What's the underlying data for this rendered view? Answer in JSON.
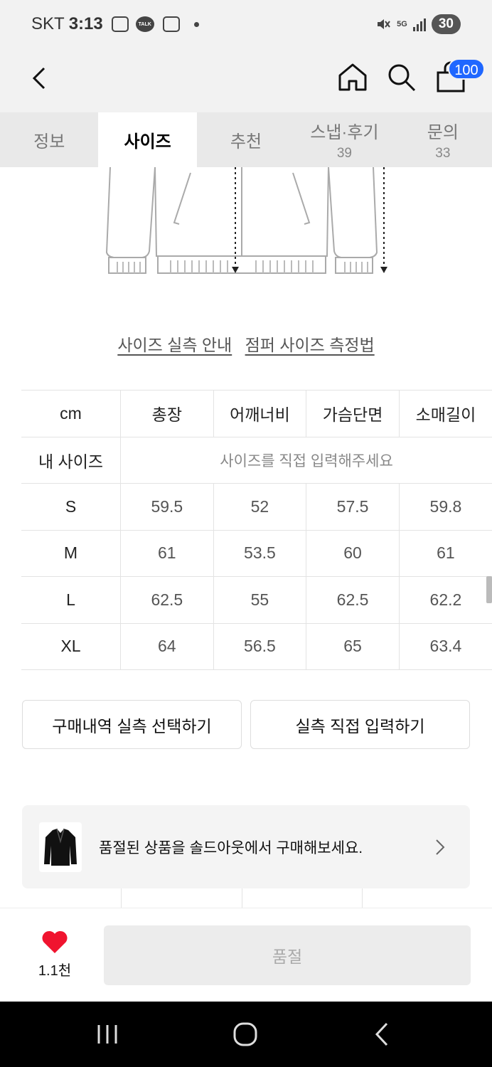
{
  "status_bar": {
    "carrier": "SKT",
    "time": "3:13",
    "talk_label": "TALK",
    "network": "5G",
    "battery": "30"
  },
  "header": {
    "cart_count": "100"
  },
  "tabs": [
    {
      "label": "정보",
      "count": ""
    },
    {
      "label": "사이즈",
      "count": ""
    },
    {
      "label": "추천",
      "count": ""
    },
    {
      "label": "스냅·후기",
      "count": "39"
    },
    {
      "label": "문의",
      "count": "33"
    }
  ],
  "active_tab": "사이즈",
  "guide_links": {
    "size_guide": "사이즈 실측 안내",
    "measure_guide": "점퍼 사이즈 측정법"
  },
  "size_table": {
    "headers": [
      "cm",
      "총장",
      "어깨너비",
      "가슴단면",
      "소매길이"
    ],
    "my_size_label": "내 사이즈",
    "my_size_prompt": "사이즈를 직접 입력해주세요",
    "rows": [
      {
        "size": "S",
        "values": [
          "59.5",
          "52",
          "57.5",
          "59.8"
        ]
      },
      {
        "size": "M",
        "values": [
          "61",
          "53.5",
          "60",
          "61"
        ]
      },
      {
        "size": "L",
        "values": [
          "62.5",
          "55",
          "62.5",
          "62.2"
        ]
      },
      {
        "size": "XL",
        "values": [
          "64",
          "56.5",
          "65",
          "63.4"
        ]
      }
    ]
  },
  "buttons": {
    "purchase_history": "구매내역 실측 선택하기",
    "direct_input": "실측 직접 입력하기"
  },
  "soldout_banner": {
    "text": "품절된 상품을 솔드아웃에서 구매해보세요."
  },
  "bottom_bar": {
    "like_count": "1.1천",
    "buy_label": "품절",
    "heart_color": "#f0142f"
  },
  "colors": {
    "badge": "#1f67ff"
  }
}
